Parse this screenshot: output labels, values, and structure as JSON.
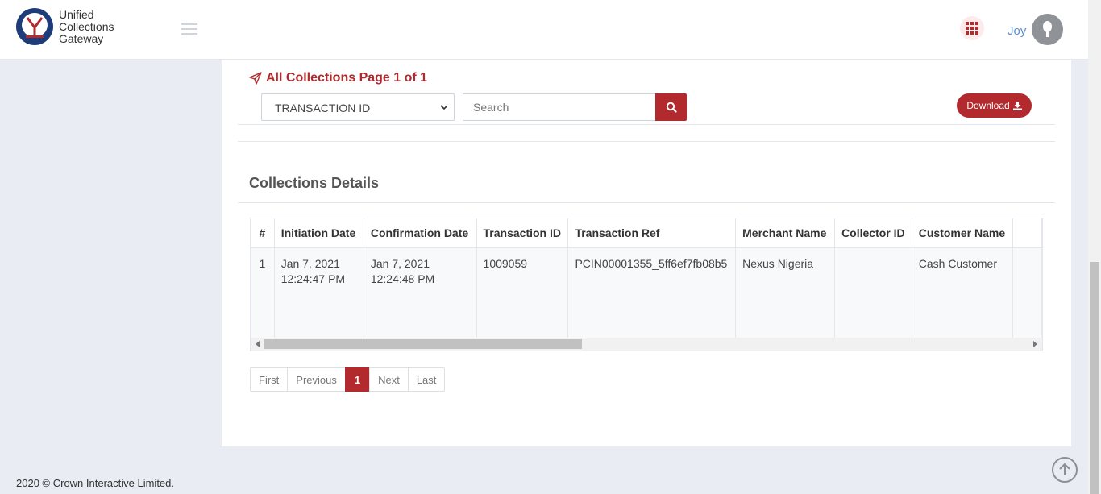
{
  "app": {
    "logo_line1": "Unified",
    "logo_line2": "Collections",
    "logo_line3": "Gateway",
    "brand_color": "#b22a2e",
    "nav_color": "#1f3c7a"
  },
  "header": {
    "user_name": "Joy",
    "apps_icon": "grid-icon",
    "avatar_icon": "user-icon"
  },
  "page": {
    "title": "All Collections Page 1 of 1",
    "filter_select_value": "TRANSACTION ID",
    "search_placeholder": "Search",
    "download_label": "Download",
    "section_title": "Collections Details"
  },
  "table": {
    "columns": [
      "#",
      "Initiation Date",
      "Confirmation Date",
      "Transaction ID",
      "Transaction Ref",
      "Merchant Name",
      "Collector ID",
      "Customer Name"
    ],
    "rows": [
      {
        "num": "1",
        "initiation_date": "Jan 7, 2021",
        "initiation_time": "12:24:47 PM",
        "confirmation_date": "Jan 7, 2021",
        "confirmation_time": "12:24:48 PM",
        "transaction_id": "1009059",
        "transaction_ref": "PCIN00001355_5ff6ef7fb08b5",
        "merchant_name": "Nexus Nigeria",
        "collector_id": "",
        "customer_name": "Cash Customer"
      }
    ]
  },
  "pagination": {
    "first": "First",
    "previous": "Previous",
    "current": "1",
    "next": "Next",
    "last": "Last"
  },
  "footer": {
    "copyright": "2020 © Crown Interactive Limited."
  }
}
